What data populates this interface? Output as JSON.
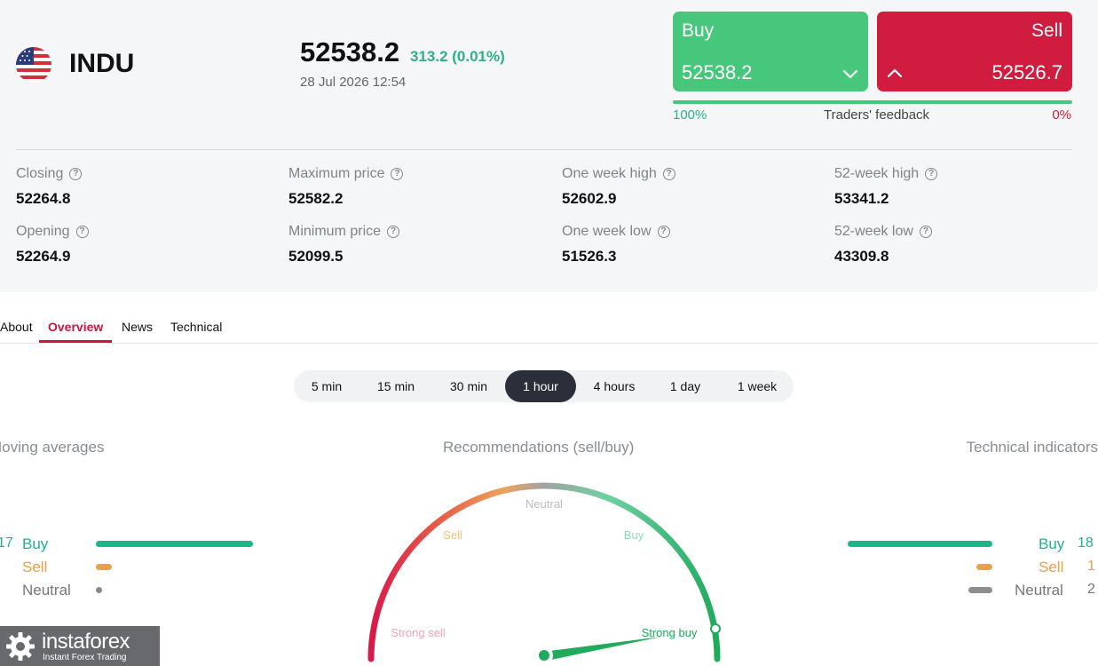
{
  "instrument": {
    "symbol": "INDU",
    "price": "52538.2",
    "change": "313.2 (0.01%)",
    "datetime": "28 Jul 2026 12:54"
  },
  "trade": {
    "buy_label": "Buy",
    "buy_price": "52538.2",
    "sell_label": "Sell",
    "sell_price": "52526.7",
    "feedback_buy_pct": "100%",
    "feedback_label": "Traders' feedback",
    "feedback_sell_pct": "0%",
    "feedback_buy_fraction": 1.0
  },
  "stats": [
    {
      "label": "Closing",
      "value": "52264.8"
    },
    {
      "label": "Opening",
      "value": "52264.9"
    },
    {
      "label": "Maximum price",
      "value": "52582.2"
    },
    {
      "label": "Minimum price",
      "value": "52099.5"
    },
    {
      "label": "One week high",
      "value": "52602.9"
    },
    {
      "label": "One week low",
      "value": "51526.3"
    },
    {
      "label": "52-week high",
      "value": "53341.2"
    },
    {
      "label": "52-week low",
      "value": "43309.8"
    }
  ],
  "tabs": [
    "About",
    "Overview",
    "News",
    "Technical"
  ],
  "active_tab": "Overview",
  "timeframes": [
    "5 min",
    "15 min",
    "30 min",
    "1 hour",
    "4 hours",
    "1 day",
    "1 week"
  ],
  "active_timeframe": "1 hour",
  "moving_averages": {
    "title": "Moving averages",
    "buy_count": "17",
    "buy_label": "Buy",
    "sell_label": "Sell",
    "neutral_label": "Neutral"
  },
  "recommendations": {
    "title": "Recommendations (sell/buy)",
    "labels": {
      "strong_sell": "Strong sell",
      "sell": "Sell",
      "neutral": "Neutral",
      "buy": "Buy",
      "strong_buy": "Strong buy"
    },
    "needle_level": "Strong buy"
  },
  "technical_indicators": {
    "title": "Technical indicators",
    "buy_label": "Buy",
    "buy_count": "18",
    "sell_label": "Sell",
    "sell_count": "1",
    "neutral_label": "Neutral",
    "neutral_count": "2"
  },
  "colors": {
    "buy": "#47c77b",
    "sell": "#d01c3f",
    "positive_text": "#2bb382",
    "bar_buy": "#1fb48a",
    "bar_sell": "#e8a04a",
    "bar_neutral": "#8e8e8e",
    "accent_tab": "#c8173d"
  },
  "logo": {
    "name": "instaforex",
    "tagline": "Instant Forex Trading"
  }
}
